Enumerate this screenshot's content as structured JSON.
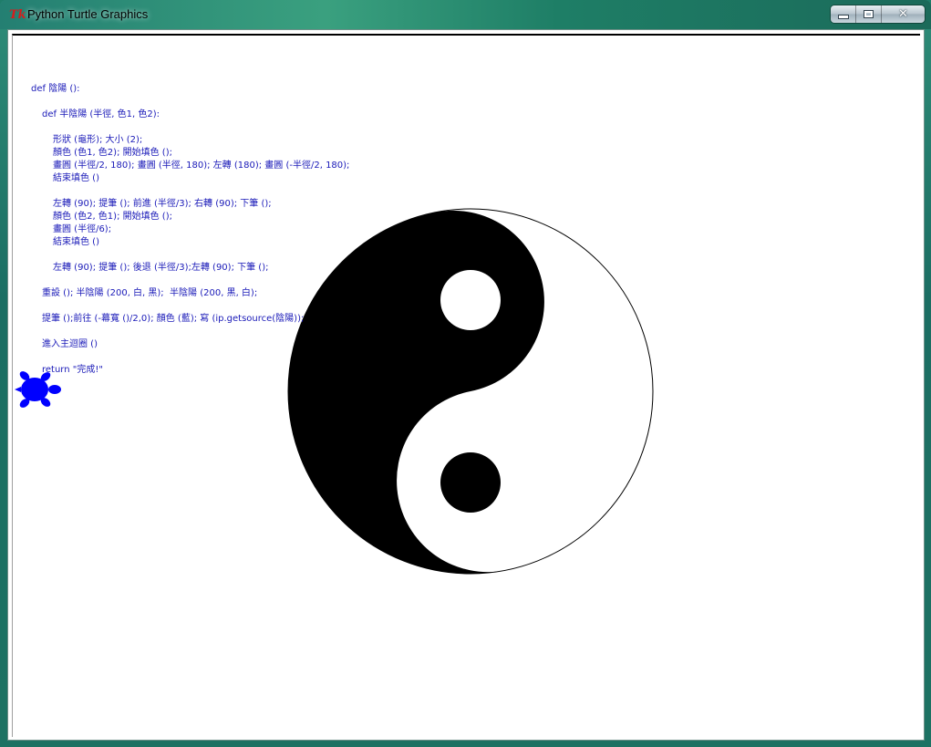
{
  "window": {
    "title": "Python Turtle Graphics",
    "icon": "tk-icon",
    "controls": {
      "minimize_icon": "minimize-icon",
      "maximize_icon": "maximize-icon",
      "close_label": "✕"
    }
  },
  "canvas": {
    "background": "#ffffff",
    "code_color": "#1a1ab8",
    "code_lines": [
      "def 陰陽 ():",
      "def 半陰陽 (半徑, 色1, 色2):",
      "形狀 (龜形); 大小 (2);",
      "顏色 (色1, 色2); 開始填色 ();",
      "畫圓 (半徑/2, 180); 畫圓 (半徑, 180); 左轉 (180); 畫圓 (-半徑/2, 180);",
      "結束填色 ()",
      "左轉 (90); 提筆 (); 前進 (半徑/3); 右轉 (90); 下筆 ();",
      "顏色 (色2, 色1); 開始填色 ();",
      "畫圓 (半徑/6);",
      "結束填色 ()",
      "左轉 (90); 提筆 (); 後退 (半徑/3);左轉 (90); 下筆 ();",
      "重設 (); 半陰陽 (200, 白, 黑);  半陰陽 (200, 黑, 白);",
      "提筆 ();前往 (-幕寬 ()/2,0); 顏色 (藍); 寫 (ip.getsource(陰陽));",
      "進入主迴圈 ()",
      "return \"完成!\""
    ],
    "yin_yang": {
      "dark_color": "#000000",
      "light_color": "#ffffff"
    },
    "turtle": {
      "shape": "turtle-icon",
      "color": "#0000ff"
    }
  }
}
